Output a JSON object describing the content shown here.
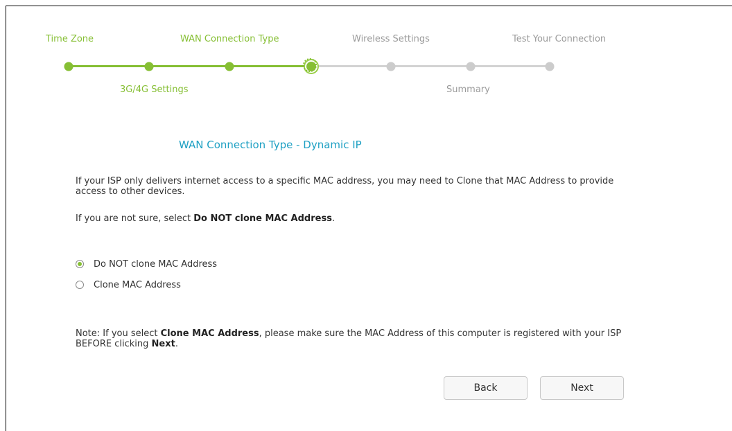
{
  "steps_top": [
    "Time Zone",
    "WAN Connection Type",
    "Wireless Settings",
    "Test Your Connection"
  ],
  "steps_bottom": [
    "3G/4G Settings",
    "Summary"
  ],
  "progress": {
    "completed_steps": 3,
    "current_step": 4,
    "total_steps": 7
  },
  "title": "WAN Connection Type - Dynamic IP",
  "info": {
    "text": "If your ISP only delivers internet access to a specific MAC address, you may need to Clone that MAC Address to provide access to other devices.",
    "hint_prefix": "If you are not sure, select ",
    "hint_bold": "Do NOT clone MAC Address",
    "hint_suffix": "."
  },
  "options": [
    {
      "label": "Do NOT clone MAC Address",
      "checked": true
    },
    {
      "label": "Clone MAC Address",
      "checked": false
    }
  ],
  "note": {
    "prefix": "Note: If you select ",
    "bold1": "Clone MAC Address",
    "middle": ", please make sure the MAC Address of this computer is registered with your ISP BEFORE clicking ",
    "bold2": "Next",
    "suffix": "."
  },
  "buttons": {
    "back": "Back",
    "next": "Next"
  },
  "colors": {
    "accent": "#86bf34",
    "title": "#1ea0c3",
    "inactive": "#cccccc"
  }
}
